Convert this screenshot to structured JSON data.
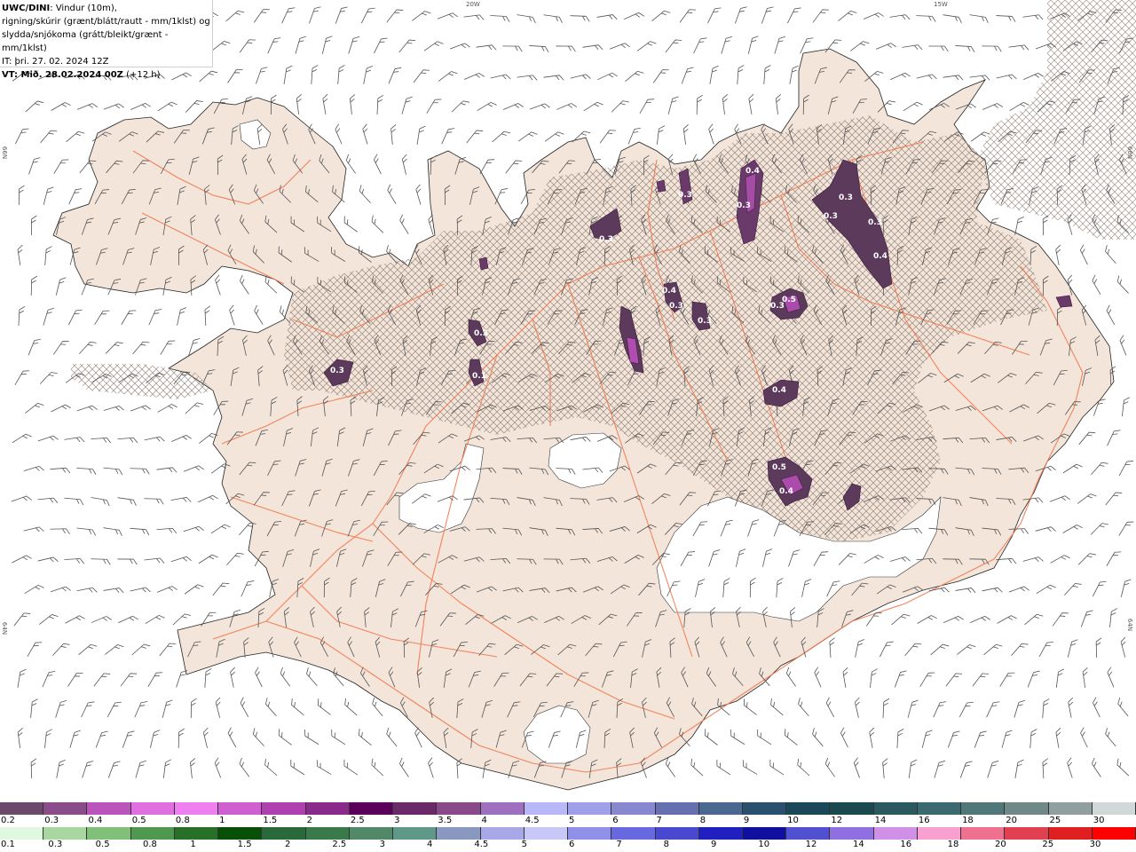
{
  "header": {
    "model": "UWC/DINI",
    "line1": ": Vindur (10m),",
    "line2": "rigning/skúrir (grænt/blátt/rautt - mm/1klst) og",
    "line3": "slydda/snjókoma (grátt/bleikt/grænt - mm/1klst)",
    "issue_time": "IT: þri. 27. 02. 2024 12Z",
    "valid_label": "VT: Mið. 28.02.2024 00Z",
    "lead_time": "(+12 h)"
  },
  "coords": {
    "lon_20w": "20W",
    "lon_15w": "15W",
    "lat_66n_left": "66N",
    "lat_64n_left": "64N",
    "lat_66n_right": "66N",
    "lat_64n_right": "64N"
  },
  "contour_labels": [
    {
      "text": "0.4"
    },
    {
      "text": "0.3"
    },
    {
      "text": "0.3"
    },
    {
      "text": "0.3"
    },
    {
      "text": "0.3"
    },
    {
      "text": "0.4"
    },
    {
      "text": "0.3"
    },
    {
      "text": "0.3"
    },
    {
      "text": "0.3"
    },
    {
      "text": "0.5"
    },
    {
      "text": "0.3"
    },
    {
      "text": "0.1"
    },
    {
      "text": "0.3"
    },
    {
      "text": "0.4"
    },
    {
      "text": "0.5"
    },
    {
      "text": "0.4"
    },
    {
      "text": "0.4"
    },
    {
      "text": "0.3"
    },
    {
      "text": "0.3"
    }
  ],
  "legend": {
    "snow_labels": [
      "0.2",
      "0.3",
      "0.4",
      "0.5",
      "0.8",
      "1",
      "1.5",
      "2",
      "2.5",
      "3",
      "3.5",
      "4",
      "4.5",
      "5",
      "6",
      "7",
      "8",
      "9",
      "10",
      "12",
      "14",
      "16",
      "18",
      "20",
      "25",
      "30"
    ],
    "snow_colors": [
      "#6b4a6b",
      "#8a4d8a",
      "#bb55bb",
      "#e070e0",
      "#f080f0",
      "#d060d0",
      "#b040b0",
      "#8a2a8a",
      "#5a005a",
      "#6a2a6a",
      "#8a4a8a",
      "#a070c0",
      "#b8b8f8",
      "#a0a0e8",
      "#8888d0",
      "#6670b0",
      "#4a6890",
      "#2a5070",
      "#1a4858",
      "#1a4a50",
      "#2a5a60",
      "#3a6a70",
      "#507878",
      "#708888",
      "#90a0a0",
      "#d0d8d8"
    ],
    "rain_labels": [
      "0.1",
      "0.3",
      "0.5",
      "0.8",
      "1",
      "1.5",
      "2",
      "2.5",
      "3",
      "4",
      "4.5",
      "5",
      "6",
      "7",
      "8",
      "9",
      "10",
      "12",
      "14",
      "16",
      "18",
      "20",
      "25",
      "30"
    ],
    "rain_colors": [
      "#e0f8e0",
      "#a8d8a0",
      "#80c078",
      "#509850",
      "#287028",
      "#085008",
      "#2a6a3a",
      "#3a7a4a",
      "#508868",
      "#609888",
      "#8898c0",
      "#a8a8e8",
      "#c8c8f8",
      "#9090e8",
      "#6868e0",
      "#4848d0",
      "#2020c0",
      "#1010a0",
      "#5050d0",
      "#9070e0",
      "#d090e8",
      "#f8a0d0",
      "#f07090",
      "#e04050",
      "#e02020",
      "#ff0000"
    ]
  },
  "colors": {
    "land": "#f3e5da",
    "road": "#f07a50",
    "glacier": "#ffffff",
    "precip_dark": "#5b3a5b",
    "precip_light": "#c050c0"
  }
}
